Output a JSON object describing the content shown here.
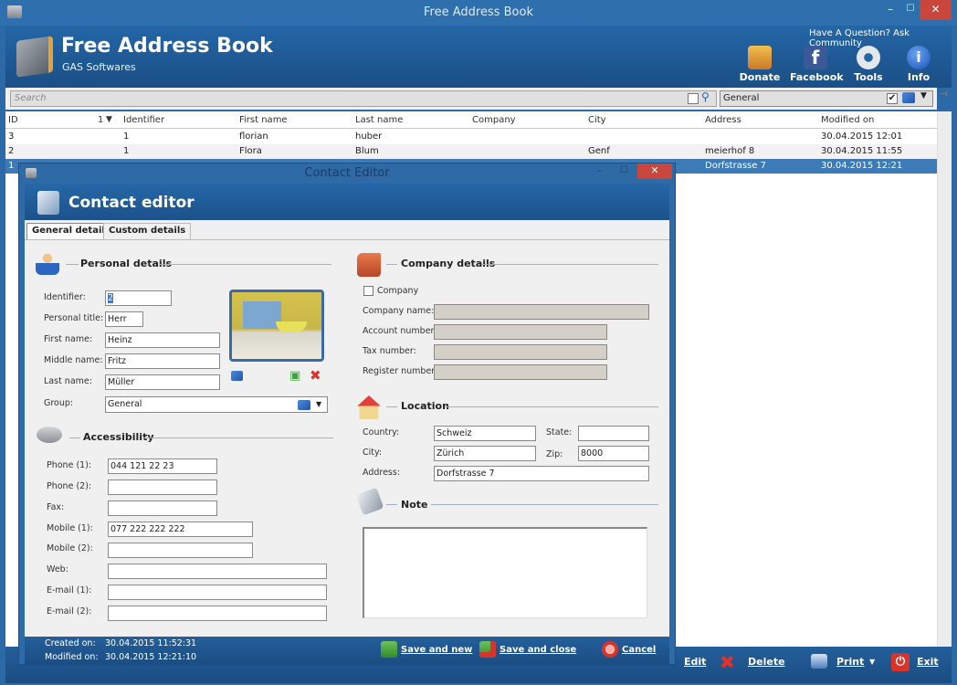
{
  "window": {
    "title": "Free Address Book",
    "minimize": "–",
    "maximize": "☐",
    "close": "✕"
  },
  "banner": {
    "title": "Free Address Book",
    "subtitle": "GAS Softwares",
    "question": "Have A Question?",
    "ask": "Ask Community",
    "tools": [
      {
        "label": "Donate",
        "icon": "donate-icon",
        "color": "#e8a33a"
      },
      {
        "label": "Facebook",
        "icon": "facebook-icon",
        "color": "#3b5998"
      },
      {
        "label": "Tools",
        "icon": "gear-icon",
        "color": "#d8dde3"
      },
      {
        "label": "Info",
        "icon": "info-icon",
        "color": "#2a6bd0"
      }
    ]
  },
  "search": {
    "placeholder": "Search",
    "group_value": "General",
    "checked_mark": "✔"
  },
  "table": {
    "headers": [
      "ID",
      "1",
      "Identifier",
      "First name",
      "Last name",
      "Company",
      "City",
      "Address",
      "Modified on"
    ],
    "sort_indicator": "▼",
    "rows": [
      {
        "id": "3",
        "identifier": "1",
        "first": "florian",
        "last": "huber",
        "company": "",
        "city": "",
        "address": "",
        "modified": "30.04.2015 12:01"
      },
      {
        "id": "2",
        "identifier": "1",
        "first": "Flora",
        "last": "Blum",
        "company": "",
        "city": "Genf",
        "address": "meierhof 8",
        "modified": "30.04.2015 11:55"
      },
      {
        "id": "1",
        "identifier": "",
        "first": "",
        "last": "",
        "company": "",
        "city": "",
        "address": "Dorfstrasse 7",
        "modified": "30.04.2015 12:21"
      }
    ]
  },
  "bottombar": {
    "edit": "Edit",
    "delete": "Delete",
    "print": "Print",
    "exit": "Exit"
  },
  "dialog": {
    "title": "Contact Editor",
    "banner_title": "Contact editor",
    "tabs": [
      "General details",
      "Custom details"
    ],
    "personal": {
      "title": "Personal details",
      "identifier_label": "Identifier:",
      "identifier": "2",
      "title_label": "Personal title:",
      "personal_title": "Herr",
      "first_label": "First name:",
      "first": "Heinz",
      "middle_label": "Middle name:",
      "middle": "Fritz",
      "last_label": "Last name:",
      "last": "Müller",
      "group_label": "Group:",
      "group": "General"
    },
    "access": {
      "title": "Accessibility",
      "phone1_label": "Phone (1):",
      "phone1": "044 121 22 23",
      "phone2_label": "Phone (2):",
      "phone2": "",
      "fax_label": "Fax:",
      "fax": "",
      "mobile1_label": "Mobile (1):",
      "mobile1": "077 222 222 222",
      "mobile2_label": "Mobile (2):",
      "mobile2": "",
      "web_label": "Web:",
      "web": "",
      "email1_label": "E-mail (1):",
      "email1": "",
      "email2_label": "E-mail (2):",
      "email2": ""
    },
    "company": {
      "title": "Company details",
      "checkbox_label": "Company",
      "name_label": "Company name:",
      "account_label": "Account number:",
      "tax_label": "Tax number:",
      "register_label": "Register number:"
    },
    "location": {
      "title": "Location",
      "country_label": "Country:",
      "country": "Schweiz",
      "state_label": "State:",
      "state": "",
      "city_label": "City:",
      "city": "Zürich",
      "zip_label": "Zip:",
      "zip": "8000",
      "address_label": "Address:",
      "address": "Dorfstrasse 7"
    },
    "note": {
      "title": "Note",
      "value": ""
    },
    "footer": {
      "created_label": "Created on:",
      "created": "30.04.2015 11:52:31",
      "modified_label": "Modified on:",
      "modified": "30.04.2015 12:21:10",
      "save_new": "Save and new",
      "save_close": "Save and close",
      "cancel": "Cancel"
    }
  }
}
